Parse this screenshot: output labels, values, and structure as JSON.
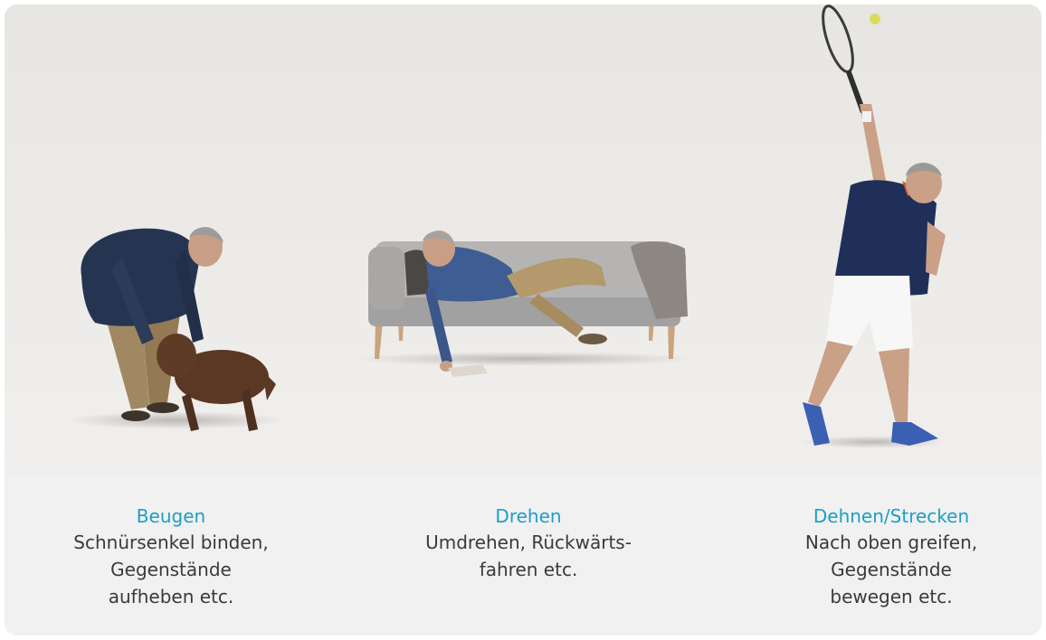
{
  "captions": [
    {
      "title": "Beugen",
      "lines": [
        "Schnürsenkel binden,",
        "Gegenstände",
        "aufheben etc."
      ]
    },
    {
      "title": "Drehen",
      "lines": [
        "Umdrehen, Rückwärts-",
        "fahren etc."
      ]
    },
    {
      "title": "Dehnen/Strecken",
      "lines": [
        "Nach oben greifen,",
        "Gegenstände",
        "bewegen etc."
      ]
    }
  ],
  "colors": {
    "accent": "#1b9fc6",
    "text": "#3a3a3a",
    "scene_bg": "#efedeb",
    "caption_bg": "#f1f1f1"
  }
}
